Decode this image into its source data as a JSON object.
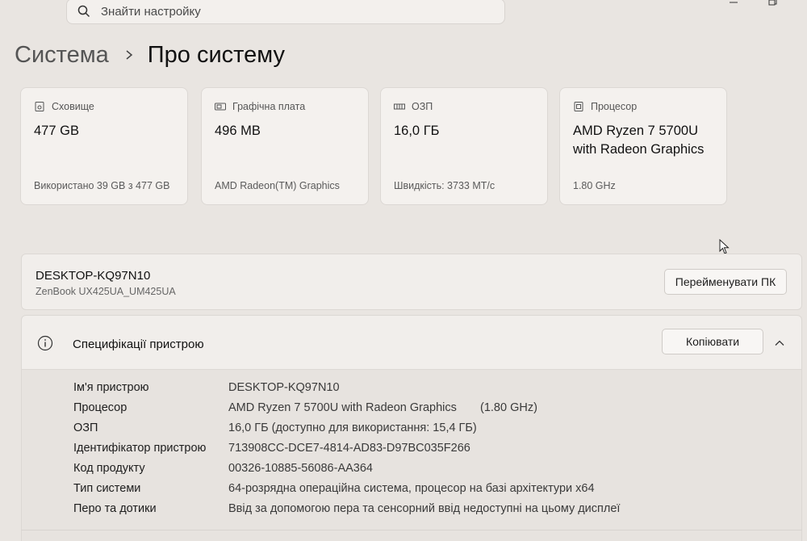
{
  "search": {
    "placeholder": "Знайти настройку"
  },
  "breadcrumb": {
    "parent": "Система",
    "current": "Про систему"
  },
  "cards": [
    {
      "icon": "storage-icon",
      "label": "Сховище",
      "value": "477 GB",
      "sub": "Використано 39 GB з 477 GB"
    },
    {
      "icon": "gpu-icon",
      "label": "Графічна плата",
      "value": "496 MB",
      "sub": "AMD Radeon(TM) Graphics"
    },
    {
      "icon": "ram-icon",
      "label": "ОЗП",
      "value": "16,0 ГБ",
      "sub": "Швидкість: 3733 МТ/с"
    },
    {
      "icon": "cpu-icon",
      "label": "Процесор",
      "value": "AMD Ryzen 7 5700U with Radeon Graphics",
      "sub": "1.80 GHz"
    }
  ],
  "device": {
    "name": "DESKTOP-KQ97N10",
    "model": "ZenBook UX425UA_UM425UA",
    "rename_label": "Перейменувати ПК"
  },
  "specs": {
    "title": "Специфікації пристрою",
    "copy_label": "Копіювати",
    "rows": [
      {
        "key": "Ім'я пристрою",
        "value": "DESKTOP-KQ97N10",
        "extra": ""
      },
      {
        "key": "Процесор",
        "value": "AMD Ryzen 7 5700U with Radeon Graphics",
        "extra": "(1.80 GHz)"
      },
      {
        "key": "ОЗП",
        "value": "16,0 ГБ (доступно для використання: 15,4 ГБ)",
        "extra": ""
      },
      {
        "key": "Ідентифікатор пристрою",
        "value": "713908CC-DCE7-4814-AD83-D97BC035F266",
        "extra": ""
      },
      {
        "key": "Код продукту",
        "value": "00326-10885-56086-AA364",
        "extra": ""
      },
      {
        "key": "Тип системи",
        "value": "64-розрядна операційна система, процесор на базі архітектури x64",
        "extra": ""
      },
      {
        "key": "Перо та дотики",
        "value": "Ввід за допомогою пера та сенсорний ввід недоступні на цьому дисплеї",
        "extra": ""
      }
    ]
  }
}
